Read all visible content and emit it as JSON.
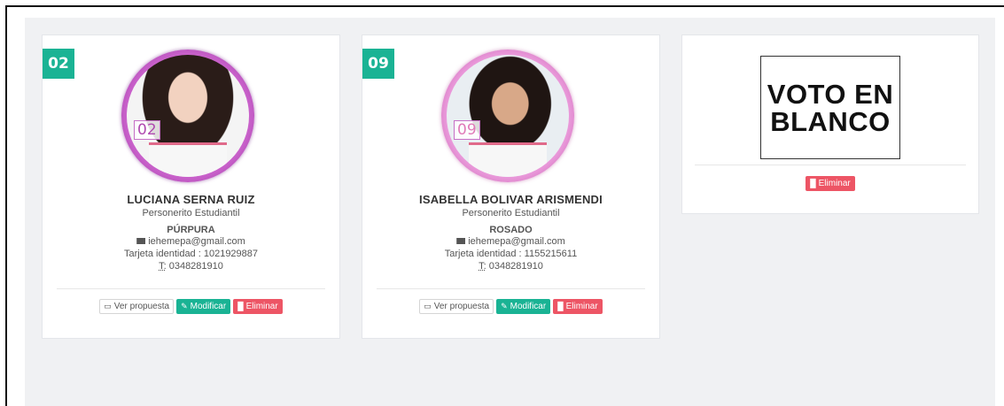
{
  "candidates": [
    {
      "number": "02",
      "photo_tag": "02",
      "name": "LUCIANA SERNA RUIZ",
      "role": "Personerito Estudiantil",
      "party": "PÚRPURA",
      "email": "iehemepa@gmail.com",
      "id_doc": "Tarjeta identidad : 1021929887",
      "phone_abbr": "T:",
      "phone": " 0348281910"
    },
    {
      "number": "09",
      "photo_tag": "09",
      "name": "ISABELLA BOLIVAR ARISMENDI",
      "role": "Personerito Estudiantil",
      "party": "ROSADO",
      "email": "iehemepa@gmail.com",
      "id_doc": "Tarjeta identidad : 1155215611",
      "phone_abbr": "T:",
      "phone": " 0348281910"
    }
  ],
  "blank_vote": {
    "line1": "VOTO EN",
    "line2": "BLANCO"
  },
  "buttons": {
    "view_proposal": "Ver propuesta",
    "modify": "Modificar",
    "delete": "Eliminar"
  },
  "colors": {
    "accent": "#1ab394",
    "danger": "#ed5565",
    "purple_ring": "#b04ab0",
    "pink_ring": "#e07ab8"
  }
}
